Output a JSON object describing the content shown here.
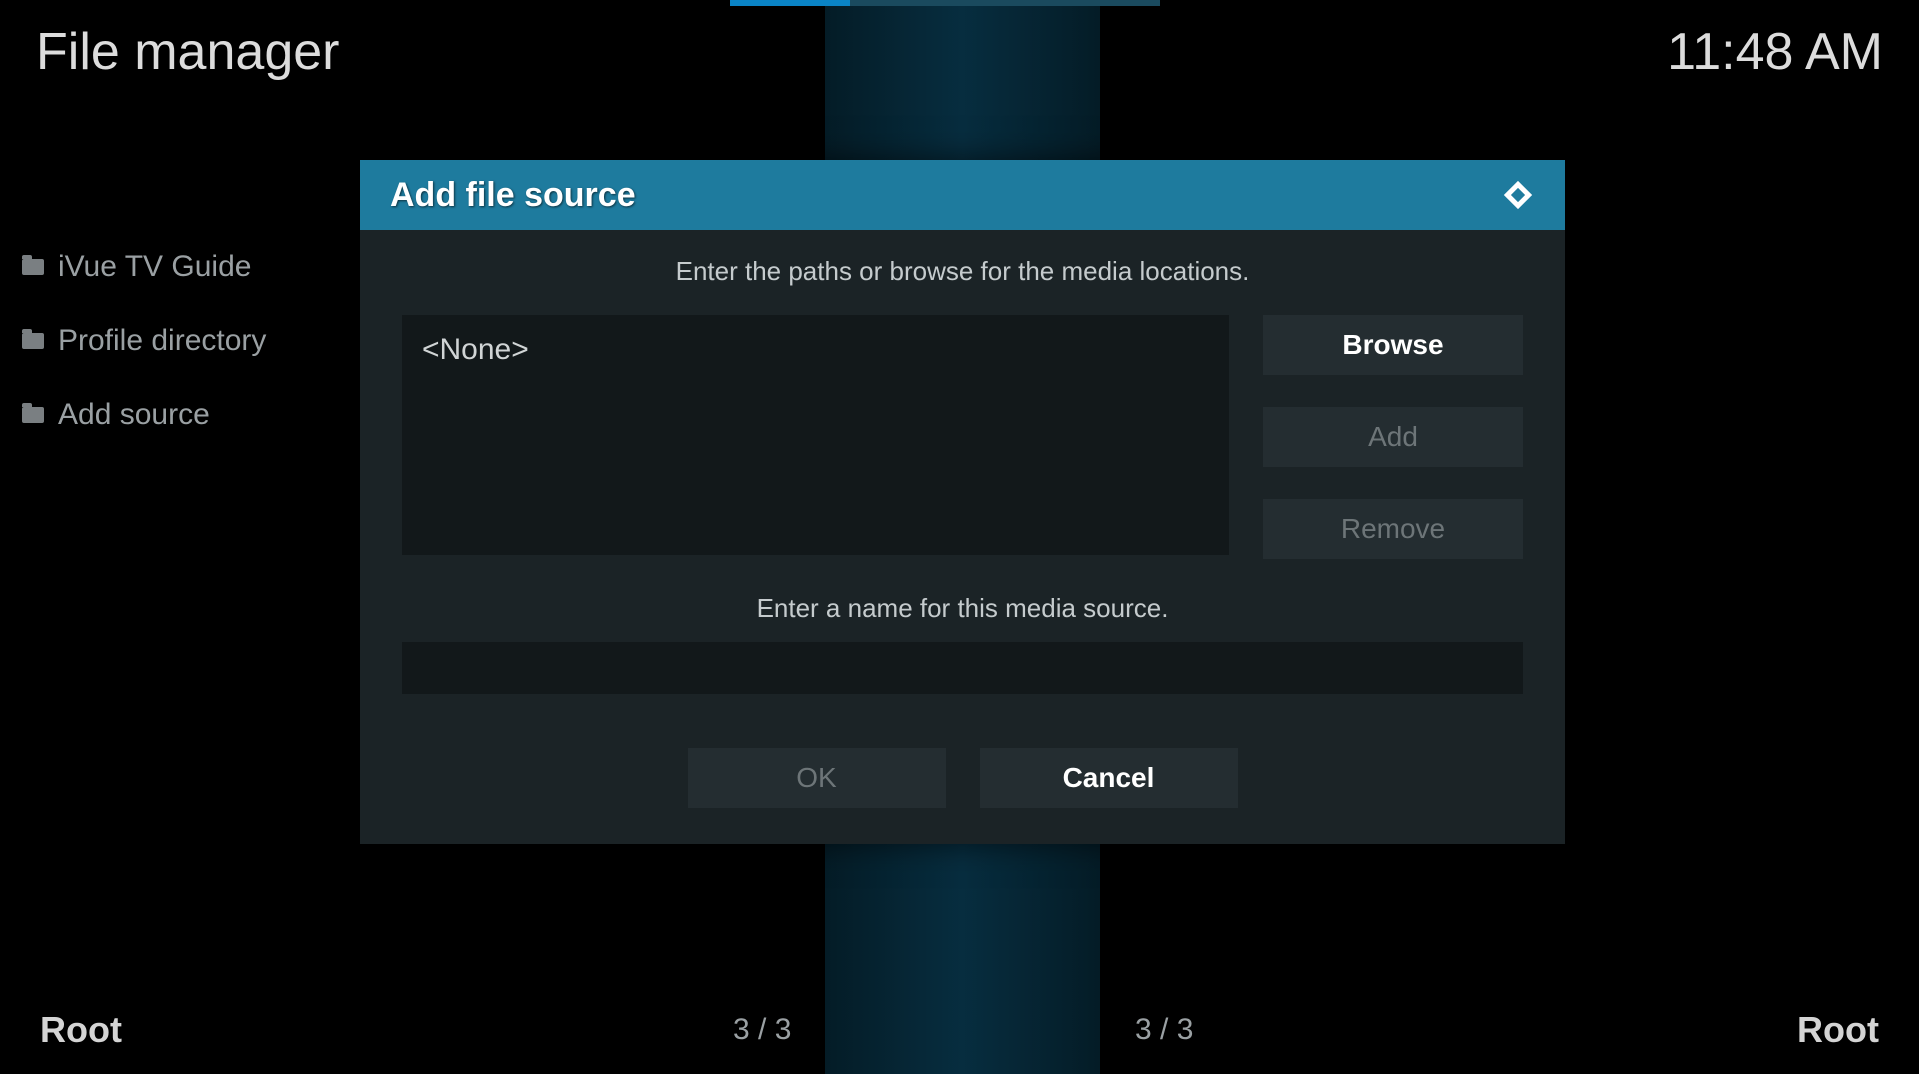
{
  "app": {
    "title": "File manager",
    "clock": "11:48 AM"
  },
  "sidebar": {
    "items": [
      {
        "label": "iVue TV Guide"
      },
      {
        "label": "Profile directory"
      },
      {
        "label": "Add source"
      }
    ]
  },
  "footer": {
    "left_label": "Root",
    "right_label": "Root",
    "left_count": "3 / 3",
    "right_count": "3 / 3"
  },
  "dialog": {
    "title": "Add file source",
    "hint_paths": "Enter the paths or browse for the media locations.",
    "path_value": "<None>",
    "browse_label": "Browse",
    "add_label": "Add",
    "remove_label": "Remove",
    "hint_name": "Enter a name for this media source.",
    "name_value": "",
    "ok_label": "OK",
    "cancel_label": "Cancel"
  }
}
